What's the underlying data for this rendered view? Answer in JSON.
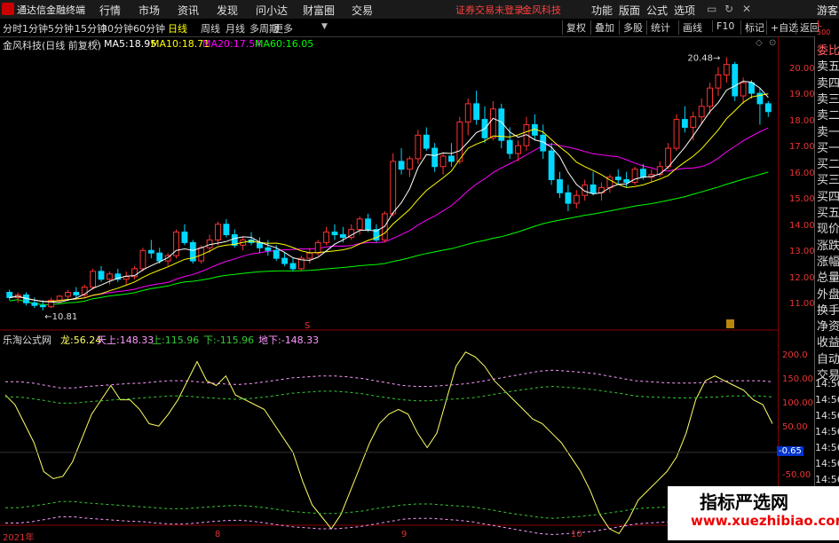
{
  "app": {
    "name": "通达信金融终端"
  },
  "menu": [
    "行情",
    "市场",
    "资讯",
    "发现",
    "问小达",
    "财富圈",
    "交易"
  ],
  "notice": {
    "text": "证券交易未登录",
    "stock": "金风科技"
  },
  "right_menu": [
    "功能",
    "版面",
    "公式",
    "选项"
  ],
  "guest": "游客",
  "periods": [
    "分时",
    "1分钟",
    "5分钟",
    "15分钟",
    "30分钟",
    "60分钟",
    "日线",
    "周线",
    "月线",
    "多周期",
    "更多"
  ],
  "active_period": "日线",
  "toolbar": [
    "复权",
    "叠加",
    "多股",
    "统计",
    "画线",
    "F10",
    "标记",
    "+自选",
    "返回"
  ],
  "main_chart": {
    "title": "金风科技(日线 前复权)",
    "ma": [
      {
        "label": "MA5:",
        "value": "18.95",
        "color": "#ffffff"
      },
      {
        "label": "MA10:",
        "value": "18.71",
        "color": "#ffff00"
      },
      {
        "label": "MA20:",
        "value": "17.54",
        "color": "#ff00ff"
      },
      {
        "label": "MA60:",
        "value": "16.05",
        "color": "#00ff00"
      }
    ],
    "high_label": "20.48",
    "low_label": "10.81",
    "y_ticks": [
      "20.00",
      "19.00",
      "18.00",
      "17.00",
      "16.00",
      "15.00",
      "14.00",
      "13.00",
      "12.00",
      "11.00"
    ],
    "corner": {
      "top": "L",
      "sub": "500"
    }
  },
  "indicator": {
    "title": "乐淘公式网",
    "values": [
      {
        "label": "龙:",
        "value": "56.24",
        "color": "#ffff66"
      },
      {
        "label": "天上:",
        "value": "148.33",
        "color": "#ff99ff"
      },
      {
        "label": "上:",
        "value": "115.96",
        "color": "#33cc33"
      },
      {
        "label": "下:",
        "value": "-115.96",
        "color": "#33cc33"
      },
      {
        "label": "地下:",
        "value": "-148.33",
        "color": "#ff99ff"
      }
    ],
    "y_ticks": [
      "200.0",
      "150.00",
      "100.00",
      "50.00",
      "-0.65",
      "-50.00",
      "-100.0"
    ],
    "current": "-0.65"
  },
  "x_labels": [
    "2021年",
    "8",
    "9",
    "10"
  ],
  "side_panel": [
    "委比",
    "卖五",
    "卖四",
    "卖三",
    "卖二",
    "卖一",
    "买一",
    "买二",
    "买三",
    "买四",
    "买五",
    "现价",
    "涨跌",
    "涨幅",
    "总量",
    "外盘",
    "换手",
    "净资",
    "收益",
    "自动",
    "交易"
  ],
  "side_times": [
    "14:56",
    "14:56",
    "14:56",
    "14:56",
    "14:56",
    "14:56",
    "14:56"
  ],
  "watermark": {
    "title": "指标严选网",
    "url": "www.xuezhibiao.com"
  },
  "chart_data": {
    "type": "candlestick",
    "ylim": [
      10.5,
      21.0
    ],
    "candles": [
      [
        11.5,
        11.6,
        11.2,
        11.3
      ],
      [
        11.3,
        11.5,
        11.1,
        11.4
      ],
      [
        11.4,
        11.5,
        11.0,
        11.1
      ],
      [
        11.1,
        11.3,
        10.9,
        11.0
      ],
      [
        11.0,
        11.2,
        10.81,
        10.95
      ],
      [
        10.95,
        11.3,
        10.9,
        11.2
      ],
      [
        11.2,
        11.4,
        11.1,
        11.35
      ],
      [
        11.35,
        11.6,
        11.2,
        11.5
      ],
      [
        11.5,
        11.7,
        11.3,
        11.4
      ],
      [
        11.4,
        11.8,
        11.3,
        11.7
      ],
      [
        11.7,
        12.4,
        11.6,
        12.3
      ],
      [
        12.3,
        12.5,
        11.9,
        12.0
      ],
      [
        12.0,
        12.3,
        11.8,
        12.2
      ],
      [
        12.2,
        12.4,
        11.9,
        12.0
      ],
      [
        12.0,
        12.3,
        11.8,
        12.1
      ],
      [
        12.1,
        12.5,
        12.0,
        12.4
      ],
      [
        12.4,
        13.2,
        12.3,
        13.1
      ],
      [
        13.1,
        13.5,
        12.8,
        13.0
      ],
      [
        13.0,
        13.2,
        12.6,
        12.7
      ],
      [
        12.7,
        13.0,
        12.5,
        12.9
      ],
      [
        12.9,
        13.9,
        12.8,
        13.8
      ],
      [
        13.8,
        14.1,
        13.3,
        13.4
      ],
      [
        13.4,
        13.5,
        12.6,
        12.7
      ],
      [
        12.7,
        13.3,
        12.6,
        13.2
      ],
      [
        13.2,
        13.7,
        13.0,
        13.5
      ],
      [
        13.5,
        14.2,
        13.3,
        14.1
      ],
      [
        14.1,
        14.3,
        13.6,
        13.7
      ],
      [
        13.7,
        13.9,
        13.2,
        13.3
      ],
      [
        13.3,
        13.6,
        13.1,
        13.5
      ],
      [
        13.5,
        13.8,
        13.3,
        13.4
      ],
      [
        13.4,
        13.6,
        13.0,
        13.2
      ],
      [
        13.2,
        13.5,
        12.9,
        13.1
      ],
      [
        13.1,
        13.3,
        12.7,
        12.8
      ],
      [
        12.8,
        13.0,
        12.5,
        12.6
      ],
      [
        12.6,
        12.8,
        12.3,
        12.4
      ],
      [
        12.4,
        12.9,
        12.3,
        12.8
      ],
      [
        12.8,
        13.2,
        12.6,
        13.0
      ],
      [
        13.0,
        13.5,
        12.9,
        13.4
      ],
      [
        13.4,
        14.0,
        13.3,
        13.8
      ],
      [
        13.8,
        14.1,
        13.5,
        13.7
      ],
      [
        13.7,
        14.0,
        13.4,
        13.6
      ],
      [
        13.6,
        14.1,
        13.5,
        13.9
      ],
      [
        13.9,
        14.4,
        13.7,
        14.3
      ],
      [
        14.3,
        14.5,
        13.8,
        13.9
      ],
      [
        13.9,
        14.1,
        13.4,
        13.5
      ],
      [
        13.5,
        14.6,
        13.4,
        14.5
      ],
      [
        14.5,
        16.8,
        14.4,
        16.5
      ],
      [
        16.5,
        17.0,
        16.0,
        16.2
      ],
      [
        16.2,
        16.7,
        15.9,
        16.6
      ],
      [
        16.6,
        17.7,
        16.4,
        17.5
      ],
      [
        17.5,
        17.8,
        16.9,
        17.0
      ],
      [
        17.0,
        17.2,
        16.1,
        16.3
      ],
      [
        16.3,
        16.8,
        16.0,
        16.7
      ],
      [
        16.7,
        17.2,
        16.3,
        16.5
      ],
      [
        16.5,
        18.2,
        16.4,
        18.0
      ],
      [
        18.0,
        18.9,
        17.5,
        18.7
      ],
      [
        18.7,
        19.2,
        17.9,
        18.1
      ],
      [
        18.1,
        18.6,
        17.2,
        17.4
      ],
      [
        17.4,
        18.8,
        17.3,
        18.5
      ],
      [
        18.5,
        18.7,
        17.0,
        17.3
      ],
      [
        17.3,
        17.8,
        16.6,
        16.8
      ],
      [
        16.8,
        17.3,
        16.5,
        17.1
      ],
      [
        17.1,
        18.2,
        16.9,
        17.9
      ],
      [
        17.9,
        18.3,
        17.3,
        17.5
      ],
      [
        17.5,
        17.9,
        16.6,
        16.9
      ],
      [
        16.9,
        17.2,
        15.6,
        15.8
      ],
      [
        15.8,
        16.1,
        15.1,
        15.3
      ],
      [
        15.3,
        15.6,
        14.6,
        14.9
      ],
      [
        14.9,
        15.4,
        14.7,
        15.2
      ],
      [
        15.2,
        15.8,
        15.0,
        15.6
      ],
      [
        15.6,
        16.1,
        15.2,
        15.3
      ],
      [
        15.3,
        15.7,
        15.0,
        15.5
      ],
      [
        15.5,
        16.0,
        15.3,
        15.9
      ],
      [
        15.9,
        16.2,
        15.6,
        15.8
      ],
      [
        15.8,
        16.1,
        15.5,
        15.7
      ],
      [
        15.7,
        16.3,
        15.6,
        16.2
      ],
      [
        16.2,
        16.4,
        15.8,
        15.9
      ],
      [
        15.9,
        16.2,
        15.7,
        16.0
      ],
      [
        16.0,
        16.5,
        15.9,
        16.3
      ],
      [
        16.3,
        17.2,
        16.2,
        17.0
      ],
      [
        17.0,
        18.3,
        16.9,
        18.1
      ],
      [
        18.1,
        18.6,
        17.6,
        17.8
      ],
      [
        17.8,
        18.4,
        17.3,
        18.2
      ],
      [
        18.2,
        18.9,
        17.9,
        18.6
      ],
      [
        18.6,
        19.5,
        18.3,
        19.3
      ],
      [
        19.3,
        20.1,
        19.0,
        19.8
      ],
      [
        19.8,
        20.48,
        19.5,
        20.2
      ],
      [
        20.2,
        20.3,
        18.8,
        19.0
      ],
      [
        19.0,
        19.7,
        18.7,
        19.5
      ],
      [
        19.5,
        19.6,
        18.9,
        19.1
      ],
      [
        19.1,
        19.3,
        17.9,
        18.7
      ],
      [
        18.7,
        18.8,
        18.2,
        18.4
      ]
    ],
    "indicator_ylim": [
      -160,
      230
    ],
    "indicator_series": [
      {
        "name": "龙",
        "values": [
          120,
          100,
          60,
          20,
          -40,
          -55,
          -50,
          -20,
          30,
          80,
          110,
          140,
          110,
          110,
          90,
          60,
          55,
          80,
          110,
          150,
          190,
          150,
          140,
          160,
          120,
          110,
          100,
          90,
          60,
          30,
          0,
          -60,
          -110,
          -135,
          -160,
          -130,
          -80,
          -30,
          20,
          60,
          80,
          90,
          80,
          40,
          10,
          40,
          110,
          180,
          210,
          200,
          180,
          150,
          130,
          110,
          90,
          70,
          60,
          40,
          20,
          -10,
          -40,
          -80,
          -130,
          -160,
          -170,
          -140,
          -100,
          -80,
          -60,
          -40,
          -10,
          40,
          110,
          150,
          160,
          150,
          140,
          130,
          110,
          100,
          60
        ]
      },
      {
        "name": "天上",
        "values": [
          148,
          148,
          145,
          140,
          135,
          135,
          138,
          140,
          142,
          144,
          145,
          148,
          150,
          150,
          148,
          145,
          143,
          142,
          144,
          148,
          152,
          156,
          158,
          160,
          160,
          158,
          155,
          150,
          145,
          140,
          138,
          138,
          140,
          142,
          145,
          150,
          155,
          160,
          165,
          170,
          172,
          170,
          168,
          165,
          160,
          155,
          150,
          148,
          146,
          145,
          145,
          146,
          148,
          150,
          150,
          150,
          148
        ]
      },
      {
        "name": "上",
        "values": [
          116,
          116,
          112,
          108,
          103,
          103,
          106,
          108,
          110,
          112,
          114,
          116,
          118,
          118,
          116,
          114,
          112,
          111,
          113,
          116,
          120,
          124,
          126,
          128,
          128,
          126,
          123,
          118,
          114,
          110,
          108,
          108,
          110,
          112,
          114,
          118,
          123,
          128,
          132,
          136,
          138,
          136,
          134,
          131,
          127,
          123,
          118,
          116,
          115,
          114,
          114,
          115,
          116,
          118,
          118,
          118,
          116
        ]
      },
      {
        "name": "下",
        "values": [
          -116,
          -116,
          -112,
          -108,
          -103,
          -103,
          -106,
          -108,
          -110,
          -112,
          -114,
          -116,
          -118,
          -118,
          -116,
          -114,
          -112,
          -111,
          -113,
          -116,
          -120,
          -124,
          -126,
          -128,
          -128,
          -126,
          -123,
          -118,
          -114,
          -110,
          -108,
          -108,
          -110,
          -112,
          -114,
          -118,
          -123,
          -128,
          -132,
          -136,
          -138,
          -136,
          -134,
          -131,
          -127,
          -123,
          -118,
          -116,
          -115,
          -114,
          -114,
          -115,
          -116,
          -118,
          -118,
          -118,
          -116
        ]
      },
      {
        "name": "地下",
        "values": [
          -148,
          -148,
          -145,
          -140,
          -135,
          -135,
          -138,
          -140,
          -142,
          -144,
          -145,
          -148,
          -150,
          -150,
          -148,
          -145,
          -143,
          -142,
          -144,
          -148,
          -152,
          -156,
          -158,
          -160,
          -160,
          -158,
          -155,
          -150,
          -145,
          -140,
          -138,
          -138,
          -140,
          -142,
          -145,
          -150,
          -155,
          -160,
          -165,
          -170,
          -172,
          -170,
          -168,
          -165,
          -160,
          -155,
          -150,
          -148,
          -146,
          -145,
          -145,
          -146,
          -148,
          -150,
          -150,
          -150,
          -148
        ]
      }
    ],
    "colors": {
      "up": "#ff3333",
      "down": "#00d8ff",
      "ma5": "#ffffff",
      "ma10": "#ffff00",
      "ma20": "#ff00ff",
      "ma60": "#00ff00"
    }
  }
}
